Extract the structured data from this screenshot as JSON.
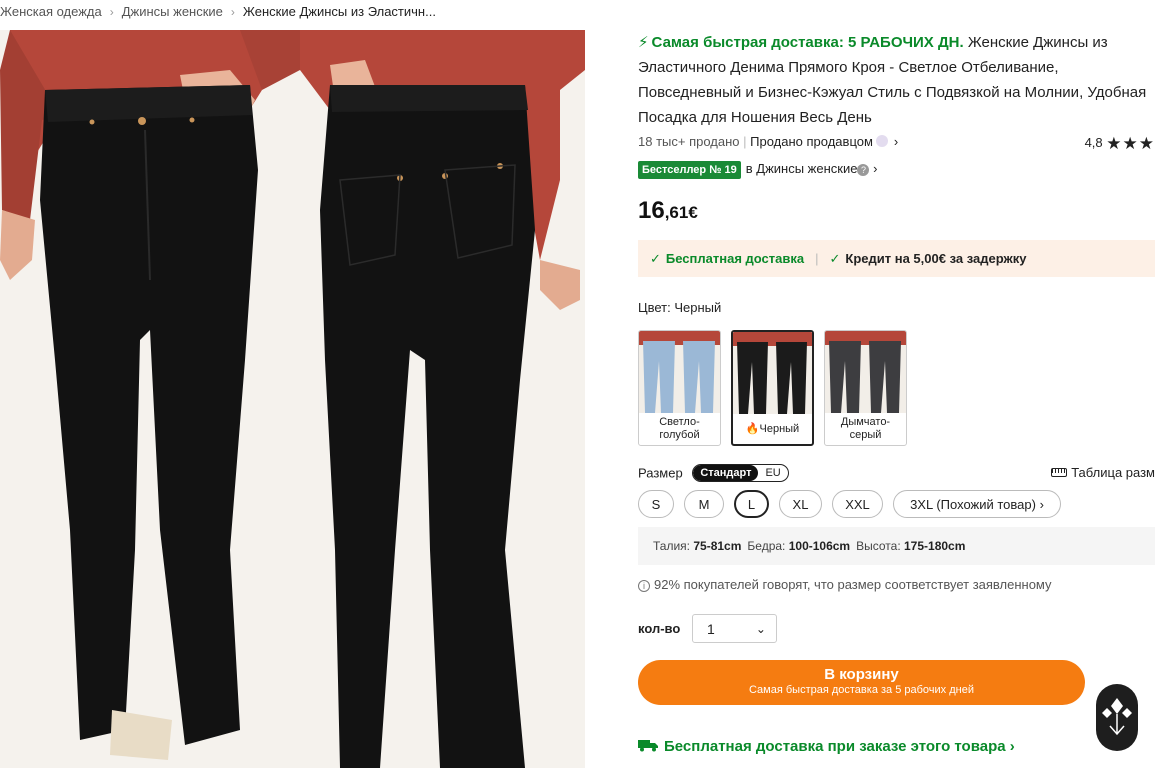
{
  "breadcrumb": {
    "items": [
      "Женская одежда",
      "Джинсы женские",
      "Женские Джинсы из Эластичн..."
    ],
    "separator": "›"
  },
  "product": {
    "fast_delivery": "Самая быстрая доставка: 5 РАБОЧИХ ДН.",
    "title": "Женские Джинсы из Эластичного Денима Прямого Кроя - Светлое Отбеливание, Повседневный и Бизнес-Кэжуал Стиль с Подвязкой на Молнии, Удобная Посадка для Ношения Весь День",
    "sold": "18 тыс+ продано",
    "seller": "Продано продавцом",
    "rating": "4,8",
    "stars": "★★★",
    "bestseller_badge": "Бестселлер № 19",
    "bestseller_category": "в Джинсы женские",
    "price_int": "16",
    "price_dec": ",61€"
  },
  "delivery": {
    "free": "Бесплатная доставка",
    "credit": "Кредит на 5,00€ за задержку"
  },
  "color": {
    "label": "Цвет: Черный",
    "options": [
      {
        "label": "Светло-голубой",
        "color": "#9bb8d6"
      },
      {
        "label": "Черный",
        "color": "#1b1b1b"
      },
      {
        "label": "Дымчато-серый",
        "color": "#3d3d40"
      }
    ]
  },
  "size": {
    "label": "Размер",
    "toggle_on": "Стандарт",
    "toggle_off": "EU",
    "table": "Таблица разм",
    "options": [
      "S",
      "M",
      "L",
      "XL",
      "XXL",
      "3XL (Похожий товар)"
    ],
    "selected": "L",
    "waist_label": "Талия:",
    "waist": "75-81cm",
    "hips_label": "Бедра:",
    "hips": "100-106cm",
    "height_label": "Высота:",
    "height": "175-180cm",
    "fit_note": "92% покупателей говорят, что размер соответствует заявленному"
  },
  "quantity": {
    "label": "кол-во",
    "value": "1"
  },
  "cart": {
    "main": "В корзину",
    "sub": "Самая быстрая доставка за 5 рабочих дней"
  },
  "free_shipping": "Бесплатная доставка при заказе этого товара",
  "colors": {
    "green": "#0a8a2a",
    "orange": "#f57c11",
    "sweater": "#b5473a",
    "jeans": "#121212"
  }
}
